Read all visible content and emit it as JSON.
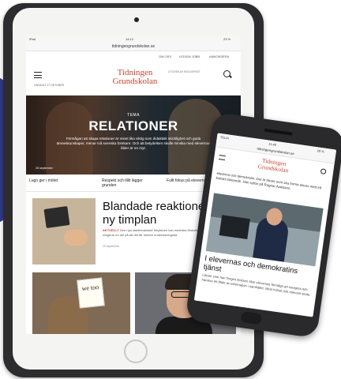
{
  "tablet": {
    "status_left": "iPad",
    "status_time": "14:12",
    "status_right": "23 %",
    "url": "tidningengrundskolan.se",
    "topnav": [
      "OM OSS",
      "LEDIGA JOBB",
      "ANNONSERA"
    ],
    "logo_line1": "Tidningen",
    "logo_line2": "Grundskolan",
    "tagline": "UTGIVEN AV SKOLVERKET",
    "date": "ONSDAG 17 OKTOBER",
    "hero": {
      "tag": "TEMA",
      "title": "RELATIONER",
      "description": "Förmågan att skapa relationer är minst lika viktig som didaktisk skicklighet och goda ämneskunskaper, menar två svenska forskare. Och att betydelsen skulle minska med elevernas ålder är en myt.",
      "date": "25 september"
    },
    "related": [
      "Lugn ger i mötet",
      "Respekt och tillit lägger grunden",
      "Fullt fokus på eleverna"
    ],
    "article": {
      "title": "Blandade reaktioner på ny timplan",
      "kicker_label": "AKTUELLT",
      "kicker_text": "Den nya stadieindelade timplanen kan innebära förändringar lokalt. Bland annat reagerar en del på att det får mindre undervisningstid.",
      "date": "25 september"
    },
    "thumb_note": "we too"
  },
  "phone": {
    "status_left": "TELIA",
    "status_time": "11:40",
    "status_right": "29 %",
    "url": "tidningengrundskolan.se",
    "logo_line1": "Tidningen",
    "logo_line2": "Grundskolan",
    "lead": "eleverna och demokratin. Det är lärare som ska forma elever med ett kritiskt tänkande. Han syftar på Ragnar Axelsson.",
    "title": "I elevernas och demokratins tjänst",
    "body": "Lärare som han Torgeir Eriksen ökar elevernas förmåga att navigera och hantera ett flöde av information i samhället. Mest Kritisk och relevant skola."
  }
}
